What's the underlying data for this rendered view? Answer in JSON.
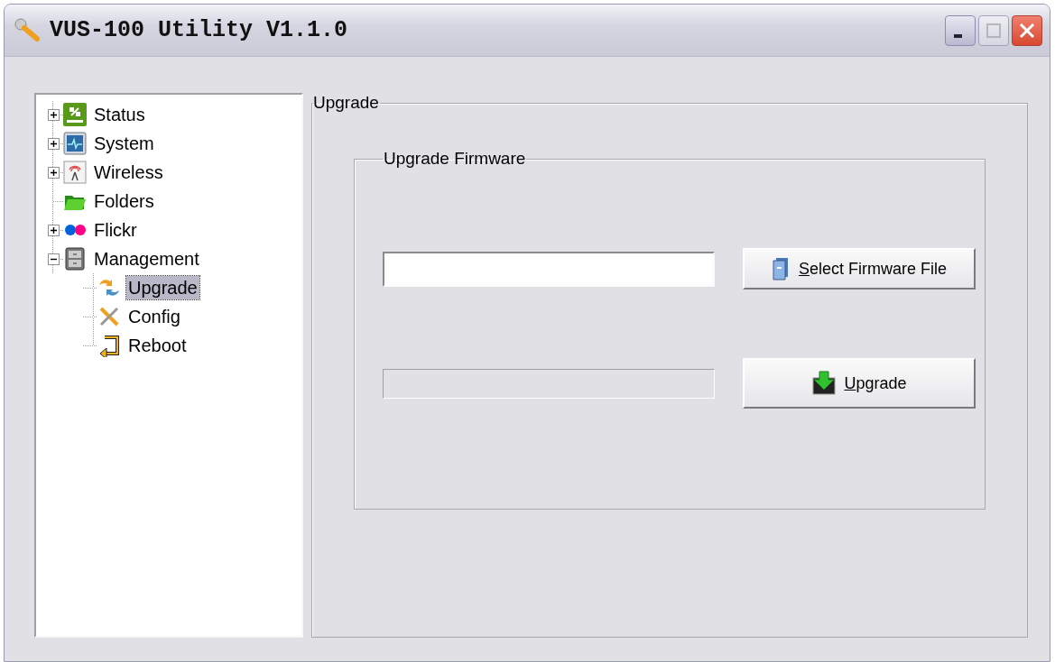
{
  "window": {
    "title": "VUS-100 Utility V1.1.0",
    "controls": [
      {
        "kind": "minimize"
      },
      {
        "kind": "maximize",
        "disabled": true
      },
      {
        "kind": "close"
      }
    ]
  },
  "tree": [
    {
      "label": "Status",
      "kind": "status",
      "expanded": false,
      "selected": false
    },
    {
      "label": "System",
      "kind": "system",
      "expanded": false,
      "selected": false
    },
    {
      "label": "Wireless",
      "kind": "wireless",
      "expanded": false,
      "selected": false
    },
    {
      "label": "Folders",
      "kind": "folder",
      "selected": false
    },
    {
      "label": "Flickr",
      "kind": "flickr",
      "expanded": false,
      "selected": false
    },
    {
      "label": "Management",
      "kind": "management",
      "expanded": true,
      "selected": false,
      "children": [
        {
          "label": "Upgrade",
          "kind": "upgrade",
          "selected": true
        },
        {
          "label": "Config",
          "kind": "config",
          "selected": false
        },
        {
          "label": "Reboot",
          "kind": "reboot",
          "selected": false
        }
      ]
    }
  ],
  "upgrade_group": {
    "title": "Upgrade",
    "firmware_group": {
      "title": "Upgrade Firmware",
      "file_field": {
        "disabled": false
      },
      "select_button": {
        "label": "Select Firmware File",
        "kind": "file",
        "underline_first": true
      },
      "progress": {
        "level": 0
      },
      "upgrade_button": {
        "label": "Upgrade",
        "kind": "download",
        "underline_first": true
      }
    }
  }
}
